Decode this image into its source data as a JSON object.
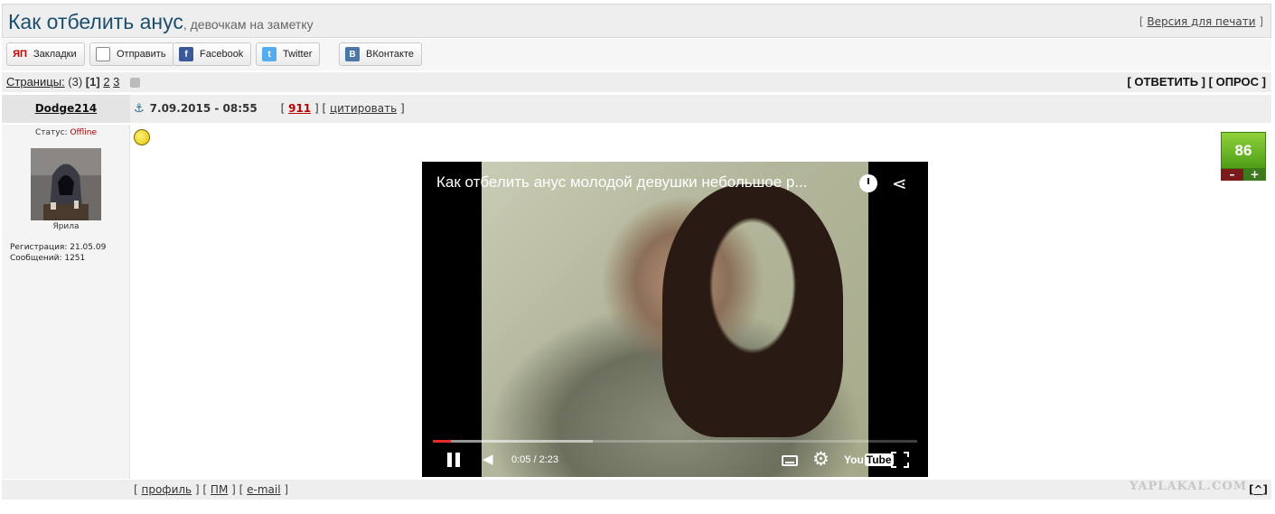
{
  "header": {
    "title": "Как отбелить анус",
    "subtitle": ", девочкам на заметку",
    "print_prefix": "[ ",
    "print_label": "Версия для печати",
    "print_suffix": " ]"
  },
  "share": {
    "bookmarks": "Закладки",
    "send": "Отправить",
    "facebook": "Facebook",
    "twitter": "Twitter",
    "vk": "ВКонтакте",
    "yap_icon": "ЯП"
  },
  "pages": {
    "label": "Страницы:",
    "count": "(3)",
    "current": "[1]",
    "page2": "2",
    "page3": "3",
    "reply": "[ ОТВЕТИТЬ ]",
    "poll": "[ ОПРОС ]"
  },
  "post": {
    "author": "Dodge214",
    "date": "7.09.2015 - 08:55",
    "number": "911",
    "quote": "цитировать",
    "status_label": "Статус:",
    "status_value": "Offline",
    "rank": "Ярила",
    "registration": "Регистрация: 21.05.09",
    "messages": "Сообщений: 1251",
    "rating": "86",
    "minus": "–",
    "plus": "+"
  },
  "video": {
    "title": "Как отбелить анус молодой девушки небольшое р...",
    "time": "0:05 / 2:23",
    "progress_played": 0.037,
    "progress_buffered": 0.33,
    "logo_you": "You",
    "logo_tube": "Tube"
  },
  "footer": {
    "profile": "профиль",
    "pm": "ПМ",
    "email": "e-mail",
    "watermark": "YAPLAKAL.COM",
    "to_top": "^"
  },
  "icons": {
    "anchor": "anchor-icon",
    "smiley": "smiley-icon",
    "clock": "watch-later-icon",
    "share": "share-icon",
    "settings": "gear-icon"
  },
  "colors": {
    "title": "#1b4f6e",
    "rating_green": "#6ab82a",
    "post_number": "#bb0000",
    "progress": "#e52d27"
  }
}
